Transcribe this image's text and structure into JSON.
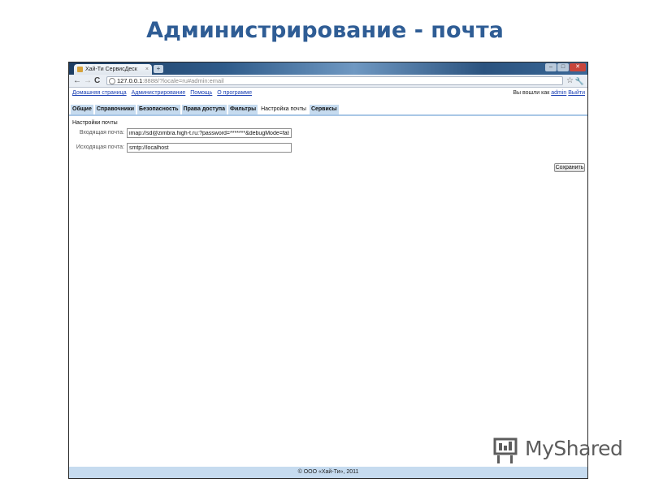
{
  "slide": {
    "title": "Администрирование - почта"
  },
  "browser": {
    "tab_title": "Хай-Ти СервисДеск",
    "tab_close": "×",
    "new_tab": "+",
    "url_host": "127.0.0.1",
    "url_rest": ":8888/?locale=ru#admin:email"
  },
  "app": {
    "top_links": [
      "Домашняя страница",
      "Администрирование",
      "Помощь",
      "О программе"
    ],
    "logged_in_prefix": "Вы вошли как",
    "username": "admin",
    "logout": "Выйти",
    "tabs": [
      {
        "label": "Общие",
        "active": false
      },
      {
        "label": "Справочники",
        "active": false
      },
      {
        "label": "Безопасность",
        "active": false
      },
      {
        "label": "Права доступа",
        "active": false
      },
      {
        "label": "Фильтры",
        "active": false
      },
      {
        "label": "Настройка почты",
        "active": true
      },
      {
        "label": "Сервисы",
        "active": false
      }
    ],
    "section_title": "Настройки почты",
    "incoming_label": "Входящая почта:",
    "incoming_value": "imap://sd@zimbra.high-t.ru:?password=*******&debugMode=false",
    "outgoing_label": "Исходящая почта:",
    "outgoing_value": "smtp://localhost",
    "save_label": "Сохранить",
    "footer": "© ООО «Хай-Ти», 2011"
  },
  "watermark": {
    "text": "MyShared"
  },
  "colors": {
    "title": "#2f5d95",
    "tab_bg": "#c6dbef",
    "link": "#1a3fb3"
  }
}
